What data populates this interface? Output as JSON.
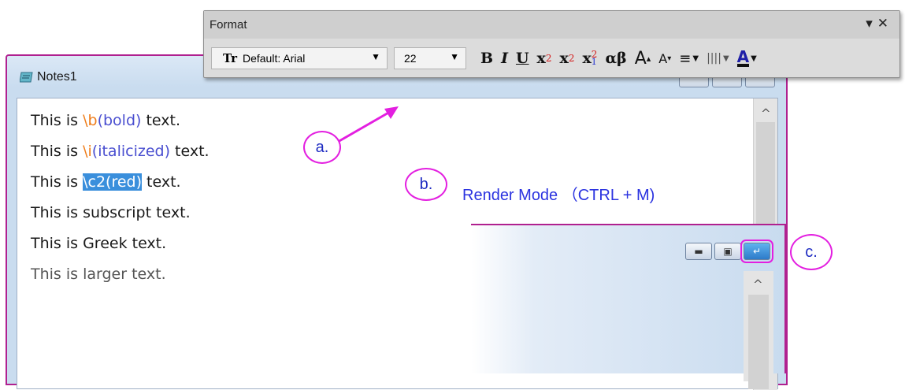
{
  "notes_window": {
    "title": "Notes1",
    "lines": [
      {
        "prefix": "This is ",
        "code": "\\b",
        "arg": "(bold)",
        "suffix": " text."
      },
      {
        "prefix": "This is ",
        "code": "\\i",
        "arg": "(italicized)",
        "suffix": " text."
      },
      {
        "prefix": "This is ",
        "selected": "\\c2(red)",
        "suffix": " text."
      },
      {
        "text": "This is subscript text."
      },
      {
        "text": "This is Greek text."
      },
      {
        "text": "This is larger text."
      }
    ]
  },
  "format_toolbar": {
    "title": "Format",
    "font": "Default: Arial",
    "size": "22",
    "buttons": {
      "bold": "B",
      "italic": "I",
      "underline": "U",
      "superscript": "x",
      "subscript": "x",
      "supsub": "x",
      "greek": "αβ",
      "increase_font": "A",
      "decrease_font": "A"
    }
  },
  "annotations": {
    "a": "a.",
    "b": "b.",
    "c": "c.",
    "render_mode": "Render Mode （CTRL + M)"
  },
  "colors": {
    "highlight": "#e31fe0",
    "window_border": "#b0208f",
    "selection": "#3a8fdc"
  }
}
